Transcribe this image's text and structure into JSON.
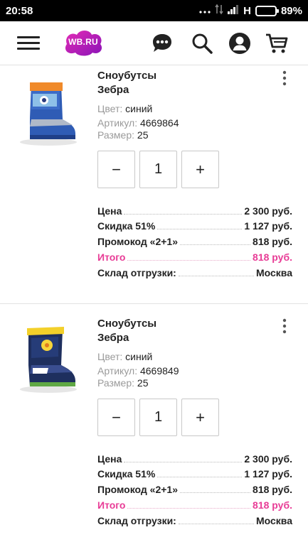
{
  "status_bar": {
    "time": "20:58",
    "network": "H",
    "battery": "89%",
    "battery_level": 0.89
  },
  "header": {
    "logo_text": "WB.RU",
    "brand_color": "#cb11ab",
    "icons": [
      "menu-icon",
      "chat-icon",
      "search-icon",
      "profile-icon",
      "cart-icon"
    ]
  },
  "products": [
    {
      "title": "Сноубутсы",
      "brand": "Зебра",
      "color_label": "Цвет:",
      "color_value": "синий",
      "article_label": "Артикул:",
      "article_value": "4669864",
      "size_label": "Размер:",
      "size_value": "25",
      "quantity": "1",
      "minus": "−",
      "plus": "+",
      "price_label": "Цена",
      "price_value": "2 300 руб.",
      "discount_label": "Скидка 51%",
      "discount_value": "1 127 руб.",
      "promo_label": "Промокод «2+1»",
      "promo_value": "818 руб.",
      "total_label": "Итого",
      "total_value": "818 руб.",
      "warehouse_label": "Склад отгрузки:",
      "warehouse_value": "Москва"
    },
    {
      "title": "Сноубутсы",
      "brand": "Зебра",
      "color_label": "Цвет:",
      "color_value": "синий",
      "article_label": "Артикул:",
      "article_value": "4669849",
      "size_label": "Размер:",
      "size_value": "25",
      "quantity": "1",
      "minus": "−",
      "plus": "+",
      "price_label": "Цена",
      "price_value": "2 300 руб.",
      "discount_label": "Скидка 51%",
      "discount_value": "1 127 руб.",
      "promo_label": "Промокод «2+1»",
      "promo_value": "818 руб.",
      "total_label": "Итого",
      "total_value": "818 руб.",
      "warehouse_label": "Склад отгрузки:",
      "warehouse_value": "Москва"
    }
  ],
  "colors": {
    "accent_total": "#e83c96",
    "muted_label": "#9a9a9a"
  }
}
